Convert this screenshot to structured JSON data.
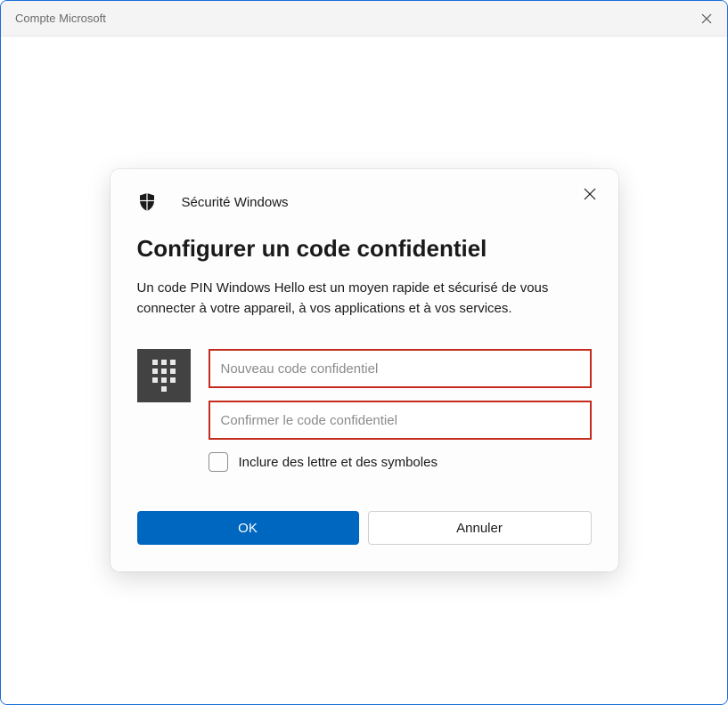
{
  "window": {
    "title": "Compte Microsoft"
  },
  "dialog": {
    "header_title": "Sécurité Windows",
    "heading": "Configurer un code confidentiel",
    "description": "Un code PIN Windows Hello est un moyen rapide et sécurisé de vous connecter à votre appareil, à vos applications et à vos services.",
    "input_new_placeholder": "Nouveau code confidentiel",
    "input_confirm_placeholder": "Confirmer le code confidentiel",
    "checkbox_label": "Inclure des lettre et des symboles",
    "ok_label": "OK",
    "cancel_label": "Annuler",
    "input_error_border_color": "#c42b1c",
    "primary_button_color": "#0067c0"
  }
}
